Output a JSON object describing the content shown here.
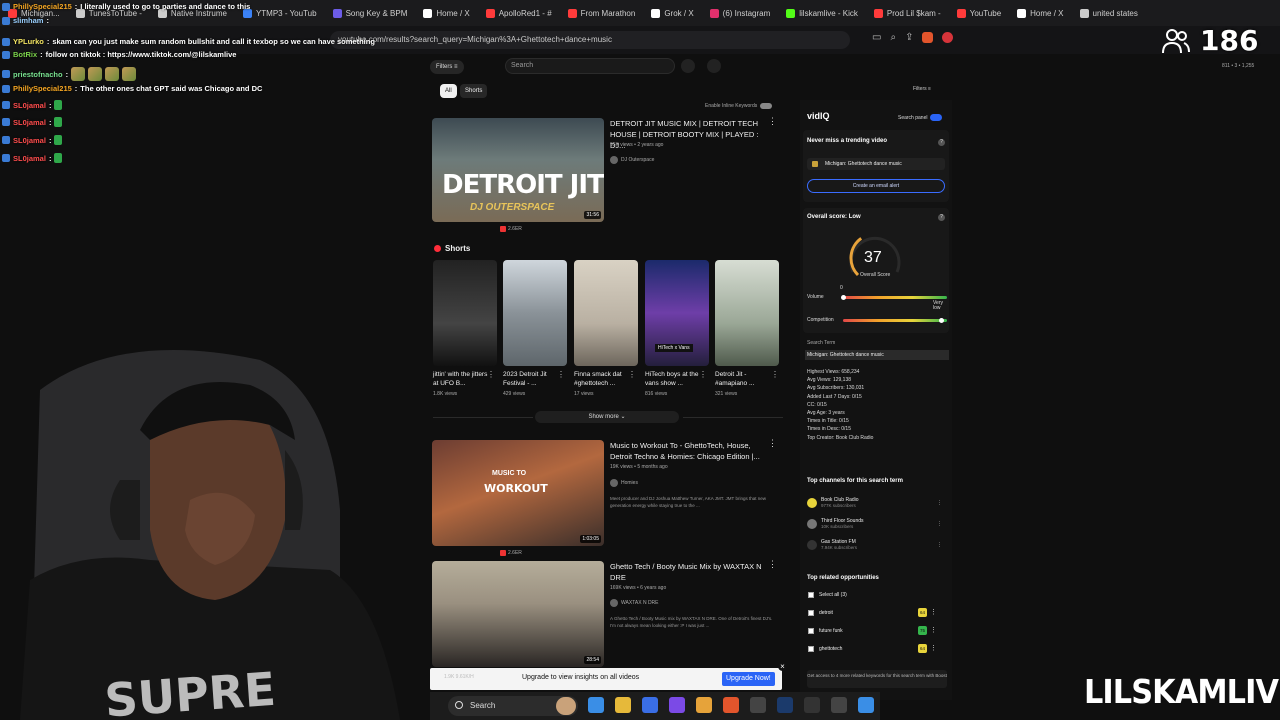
{
  "tabs": [
    {
      "label": "Michigan...",
      "color": "#ff3b3b"
    },
    {
      "label": "TunesToTube -",
      "color": "#cccccc"
    },
    {
      "label": "Native Instrume",
      "color": "#cccccc"
    },
    {
      "label": "YTMP3 - YouTub",
      "color": "#3b82f6"
    },
    {
      "label": "Song Key & BPM",
      "color": "#6c5ce7"
    },
    {
      "label": "Home / X",
      "color": "#ffffff"
    },
    {
      "label": "ApolloRed1 - #",
      "color": "#ff3b3b"
    },
    {
      "label": "From Marathon",
      "color": "#ff3b3b"
    },
    {
      "label": "Grok / X",
      "color": "#ffffff"
    },
    {
      "label": "(6) Instagram",
      "color": "#e1306c"
    },
    {
      "label": "lilskamlive - Kick",
      "color": "#53fc18"
    },
    {
      "label": "Prod Lil $kam -",
      "color": "#ff3b3b"
    },
    {
      "label": "YouTube",
      "color": "#ff3b3b"
    },
    {
      "label": "Home / X",
      "color": "#ffffff"
    },
    {
      "label": "united states",
      "color": "#cccccc"
    }
  ],
  "address": "youtube.com/results?search_query=Michigan%3A+Ghettotech+dance+music",
  "viewer_count": "186",
  "chat": [
    {
      "user": "PhillySpecial215",
      "user_color": "#f5a623",
      "text": "I literally used to go to parties and dance to this"
    },
    {
      "user": "slimham",
      "user_color": "#9ad0ff",
      "text": ""
    },
    {
      "user": "YPLurko",
      "user_color": "#f5e663",
      "text": "skam can you just make sum random bullshit and call it texbop so we can have something"
    },
    {
      "user": "BotRix",
      "user_color": "#7bd34b",
      "text": "follow on tiktok : https://www.tiktok.com/@lilskamlive"
    },
    {
      "user": "priestofnacho",
      "user_color": "#78e08f",
      "text": ""
    },
    {
      "user": "PhillySpecial215",
      "user_color": "#f5a623",
      "text": "The other ones chat GPT said was Chicago and DC"
    },
    {
      "user": "SL0jamal",
      "user_color": "#ff4d4d",
      "text": ""
    },
    {
      "user": "SL0jamal",
      "user_color": "#ff4d4d",
      "text": ""
    },
    {
      "user": "SL0jamal",
      "user_color": "#ff4d4d",
      "text": ""
    },
    {
      "user": "SL0jamal",
      "user_color": "#ff4d4d",
      "text": ""
    }
  ],
  "yt": {
    "filters_label": "Filters",
    "search_placeholder": "Search",
    "chip_all": "All",
    "chip_shorts": "Shorts",
    "inline_keywords_label": "Enable Inline Keywords",
    "video1": {
      "title": "DETROIT JIT MUSIC MIX | DETROIT TECH HOUSE | DETROIT BOOTY MIX | PLAYED : DJ...",
      "meta": "95K views • 2 years ago",
      "channel": "DJ Outerspace",
      "thumb_big": "DETROIT JIT",
      "thumb_sub": "DJ OUTERSPACE",
      "duration": "31:56",
      "stat": "2.6ER"
    },
    "shorts_heading": "Shorts",
    "shorts": [
      {
        "title": "jittin' with the jitters at UFO B...",
        "views": "1.8K views"
      },
      {
        "title": "2023 Detroit Jit Festival - ...",
        "views": "429 views"
      },
      {
        "title": "Finna smack dat #ghettotech ...",
        "views": "17 views"
      },
      {
        "title": "HiTech boys at the vans show ...",
        "views": "816 views",
        "tag": "HiTech x Vans"
      },
      {
        "title": "Detroit Jit - #amapiano ...",
        "views": "321 views"
      }
    ],
    "show_more": "Show more",
    "video2": {
      "title": "Music to Workout To - GhettoTech, House, Detroit Techno & Homies: Chicago Edition |...",
      "meta": "19K views • 5 months ago",
      "channel": "Homies",
      "thumb_line1": "MUSIC TO",
      "thumb_line2": "WORKOUT",
      "desc": "Meet producer and DJ Joshua Matthew Turner, AKA JMT. JMT brings that new generation energy while staying true to the ...",
      "duration": "1:03:05",
      "stat": "2.6ER"
    },
    "video3": {
      "title": "Ghetto Tech / Booty Music Mix by WAXTAX N DRE",
      "meta": "169K views • 6 years ago",
      "channel": "WAXTAX N DRE",
      "desc": "A Ghetto Tech / Booty Music mix by WAXTAX N DRE. One of Detroit's finest DJ's. I'm not always mean looking either :P I was just ...",
      "duration": "28:54"
    },
    "upgrade_text": "Upgrade to view insights on all videos",
    "upgrade_button": "Upgrade Now!",
    "upgrade_pill": "1.9K  9.61K/H"
  },
  "vidiq": {
    "filters": "Filters",
    "logo": "vidIQ",
    "search_panel": "Search panel",
    "trend_heading": "Never miss a trending video",
    "alert_keyword": "Michigan: Ghettotech dance music",
    "alert_button": "Create an email alert",
    "overall_heading": "Overall score: Low",
    "score": "37",
    "score_label": "Overall Score",
    "score_fraction": 0.37,
    "volume_label": "Volume",
    "volume_value": "0",
    "very_low": "Very low",
    "competition_label": "Competition",
    "search_term_label": "Search Term",
    "search_term": "Michigan: Ghettotech dance music",
    "stats": [
      "Highest Views: 658,234",
      "Avg Views: 129,138",
      "Avg Subscribers: 130,031",
      "Added Last 7 Days: 0/15",
      "CC: 0/15",
      "Avg Age: 3 years",
      "Times in Title: 0/15",
      "Times in Desc: 0/15",
      "Top Creator: Book Club Radio"
    ],
    "top_channels_heading": "Top channels for this search term",
    "channels": [
      {
        "name": "Book Club Radio",
        "subs": "977K subscribers",
        "color": "#e8d43b"
      },
      {
        "name": "Third Floor Sounds",
        "subs": "10K subscribers",
        "color": "#777777"
      },
      {
        "name": "Gas Station FM",
        "subs": "7.94K subscribers",
        "color": "#333333"
      }
    ],
    "opps_heading": "Top related opportunities",
    "select_all": "Select all (3)",
    "opps": [
      {
        "label": "detroit",
        "score": "64",
        "color": "#e8d43b"
      },
      {
        "label": "future funk",
        "score": "75",
        "color": "#34b54c"
      },
      {
        "label": "ghettotech",
        "score": "64",
        "color": "#e8d43b"
      }
    ],
    "promo": "Get access to 4 more related keywords for this search term with Boost"
  },
  "right_stats": "811 • 3 • 1,255",
  "brand_overlay": "LILSKAMLIVE",
  "taskbar": {
    "search": "Search"
  }
}
